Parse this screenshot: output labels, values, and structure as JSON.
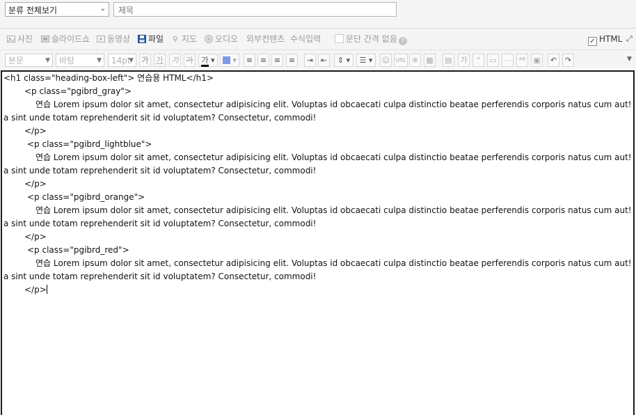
{
  "header": {
    "category": "분류 전체보기",
    "title_placeholder": "제목"
  },
  "insert_toolbar": {
    "photo": "사진",
    "slideshow": "슬라이드쇼",
    "video": "동영상",
    "file": "파일",
    "map": "지도",
    "audio": "오디오",
    "external": "외부컨텐츠",
    "formula": "수식입력",
    "no_spacing": "문단 간격 없음",
    "help": "?",
    "html_label": "HTML"
  },
  "format_toolbar": {
    "style": "본문",
    "font": "바탕",
    "size": "14pt",
    "url": "URL"
  },
  "code": {
    "h1_open": "<h1 class=\"heading-box-left\"> 연습용 HTML</h1>",
    "p_gray_open": "<p class=\"pgibrd_gray\">",
    "p_lightblue_open": "<p class=\"pgibrd_lightblue\">",
    "p_orange_open": "<p class=\"pgibrd_orange\">",
    "p_red_open": "<p class=\"pgibrd_red\">",
    "para_line1": "연습 Lorem ipsum dolor sit amet, consectetur adipisicing elit. Voluptas id obcaecati culpa distinctio beatae perferendis corporis natus cum aut! Porro dict",
    "para_line2": "a sint unde totam reprehenderit sit id voluptatem? Consectetur, commodi!",
    "p_close": "</p>"
  }
}
